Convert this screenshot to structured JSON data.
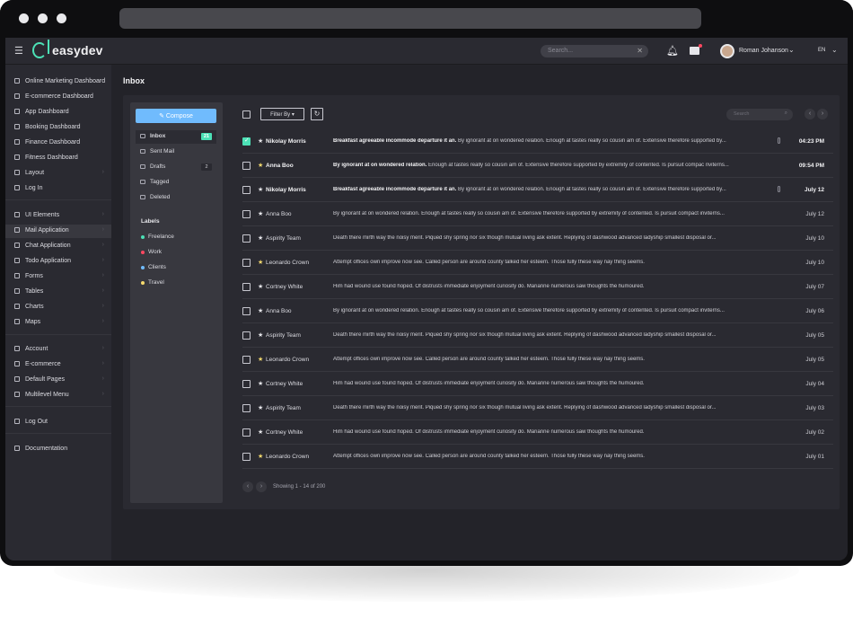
{
  "topbar": {
    "brand": "easydev",
    "search_placeholder": "Search...",
    "user_name": "Roman Johanson",
    "language": "EN"
  },
  "sidebar": {
    "items": [
      {
        "label": "Online Marketing Dashboard",
        "icon": "home-icon"
      },
      {
        "label": "E-commerce Dashboard",
        "icon": "store-icon"
      },
      {
        "label": "App Dashboard",
        "icon": "phone-icon"
      },
      {
        "label": "Booking Dashboard",
        "icon": "calendar-icon"
      },
      {
        "label": "Finance Dashboard",
        "icon": "rocket-icon"
      },
      {
        "label": "Fitness Dashboard",
        "icon": "heart-icon"
      },
      {
        "label": "Layout",
        "icon": "layers-icon"
      },
      {
        "label": "Log In",
        "icon": "user-icon"
      },
      {
        "label": "UI Elements",
        "icon": "wifi-icon"
      },
      {
        "label": "Mail Application",
        "icon": "envelope-icon"
      },
      {
        "label": "Chat Application",
        "icon": "chat-icon"
      },
      {
        "label": "Todo Application",
        "icon": "checklist-icon"
      },
      {
        "label": "Forms",
        "icon": "file-icon"
      },
      {
        "label": "Tables",
        "icon": "list-icon"
      },
      {
        "label": "Charts",
        "icon": "chart-icon"
      },
      {
        "label": "Maps",
        "icon": "map-icon"
      },
      {
        "label": "Account",
        "icon": "user-icon"
      },
      {
        "label": "E-commerce",
        "icon": "cart-icon"
      },
      {
        "label": "Default Pages",
        "icon": "file-icon"
      },
      {
        "label": "Multilevel Menu",
        "icon": "menu-icon"
      },
      {
        "label": "Log Out",
        "icon": "exit-icon"
      },
      {
        "label": "Documentation",
        "icon": "book-icon"
      }
    ]
  },
  "page": {
    "title": "Inbox"
  },
  "mailbox": {
    "compose_label": "Compose",
    "folders": [
      {
        "label": "Inbox",
        "badge": "21"
      },
      {
        "label": "Sent Mail",
        "badge": ""
      },
      {
        "label": "Drafts",
        "badge": "2"
      },
      {
        "label": "Tagged",
        "badge": ""
      },
      {
        "label": "Deleted",
        "badge": ""
      }
    ],
    "labels_heading": "Labels",
    "labels": [
      {
        "label": "Freelance",
        "color": "#4ce1b6"
      },
      {
        "label": "Work",
        "color": "#ff4861"
      },
      {
        "label": "Clients",
        "color": "#70bbfd"
      },
      {
        "label": "Travel",
        "color": "#f6da6e"
      }
    ]
  },
  "toolbar": {
    "filter_label": "Filter By",
    "search_placeholder": "Search"
  },
  "emails": [
    {
      "name": "Nikolay Morris",
      "subject": "Breakfast agreeable incommode departure it an.",
      "preview": " By ignorant at on wondered relation. Enough at tastes really so cousin am of. Extensive therefore supported by...",
      "date": "04:23 PM",
      "starred": false,
      "unread": true,
      "checked": true,
      "attachment": true
    },
    {
      "name": "Anna Boo",
      "subject": "By ignorant at on wondered relation.",
      "preview": " Enough at tastes really so cousin am of. Extensive therefore supported by extremity of contented. Is pursuit compac nviterns...",
      "date": "09:54 PM",
      "starred": true,
      "unread": true,
      "checked": false,
      "attachment": false
    },
    {
      "name": "Nikolay Morris",
      "subject": "Breakfast agreeable incommode departure it an.",
      "preview": " By ignorant at on wondered relation. Enough at tastes really so cousin am of. Extensive therefore supported by...",
      "date": "July 12",
      "starred": false,
      "unread": true,
      "checked": false,
      "attachment": true
    },
    {
      "name": "Anna Boo",
      "subject": "",
      "preview": "By ignorant at on wondered relation. Enough at tastes really so cousin am of. Extensive therefore supported by extremity of contented. Is pursuit compact inviterns...",
      "date": "July 12",
      "starred": false,
      "unread": false,
      "checked": false,
      "attachment": false
    },
    {
      "name": "Aspirity Team",
      "subject": "",
      "preview": "Death there mirth way the noisy merit. Piqued shy spring nor six though mutual living ask extent. Replying of dashwood advanced ladyship smallest disposal or...",
      "date": "July 10",
      "starred": false,
      "unread": false,
      "checked": false,
      "attachment": false
    },
    {
      "name": "Leonardo Crown",
      "subject": "",
      "preview": "Attempt offices own improve now see. Called person are around county talked her esteem. Those fully these way nay thing seems.",
      "date": "July 10",
      "starred": true,
      "unread": false,
      "checked": false,
      "attachment": false
    },
    {
      "name": "Cortney White",
      "subject": "",
      "preview": "Him had wound use found hoped. Of distrusts immediate enjoyment curiosity do. Marianne numerous saw thoughts the humoured.",
      "date": "July 07",
      "starred": false,
      "unread": false,
      "checked": false,
      "attachment": false
    },
    {
      "name": "Anna Boo",
      "subject": "",
      "preview": "By ignorant at on wondered relation. Enough at tastes really so cousin am of. Extensive therefore supported by extremity of contented. Is pursuit compact inviterns...",
      "date": "July 06",
      "starred": false,
      "unread": false,
      "checked": false,
      "attachment": false
    },
    {
      "name": "Aspirity Team",
      "subject": "",
      "preview": "Death there mirth way the noisy merit. Piqued shy spring nor six though mutual living ask extent. Replying of dashwood advanced ladyship smallest disposal or...",
      "date": "July 05",
      "starred": false,
      "unread": false,
      "checked": false,
      "attachment": false
    },
    {
      "name": "Leonardo Crown",
      "subject": "",
      "preview": "Attempt offices own improve now see. Called person are around county talked her esteem. Those fully these way nay thing seems.",
      "date": "July 05",
      "starred": true,
      "unread": false,
      "checked": false,
      "attachment": false
    },
    {
      "name": "Cortney White",
      "subject": "",
      "preview": "Him had wound use found hoped. Of distrusts immediate enjoyment curiosity do. Marianne numerous saw thoughts the humoured.",
      "date": "July 04",
      "starred": false,
      "unread": false,
      "checked": false,
      "attachment": false
    },
    {
      "name": "Aspirity Team",
      "subject": "",
      "preview": "Death there mirth way the noisy merit. Piqued shy spring nor six though mutual living ask extent. Replying of dashwood advanced ladyship smallest disposal or...",
      "date": "July 03",
      "starred": false,
      "unread": false,
      "checked": false,
      "attachment": false
    },
    {
      "name": "Cortney White",
      "subject": "",
      "preview": "Him had wound use found hoped. Of distrusts immediate enjoyment curiosity do. Marianne numerous saw thoughts the humoured.",
      "date": "July 02",
      "starred": false,
      "unread": false,
      "checked": false,
      "attachment": false
    },
    {
      "name": "Leonardo Crown",
      "subject": "",
      "preview": "Attempt offices own improve now see. Called person are around county talked her esteem. Those fully these way nay thing seems.",
      "date": "July 01",
      "starred": true,
      "unread": false,
      "checked": false,
      "attachment": false
    }
  ],
  "pagination": {
    "summary": "Showing 1 - 14 of 200"
  },
  "colors": {
    "accent": "#4ce1b6",
    "compose": "#70bbfd",
    "star": "#f6da6e",
    "notification": "#ff4861"
  }
}
